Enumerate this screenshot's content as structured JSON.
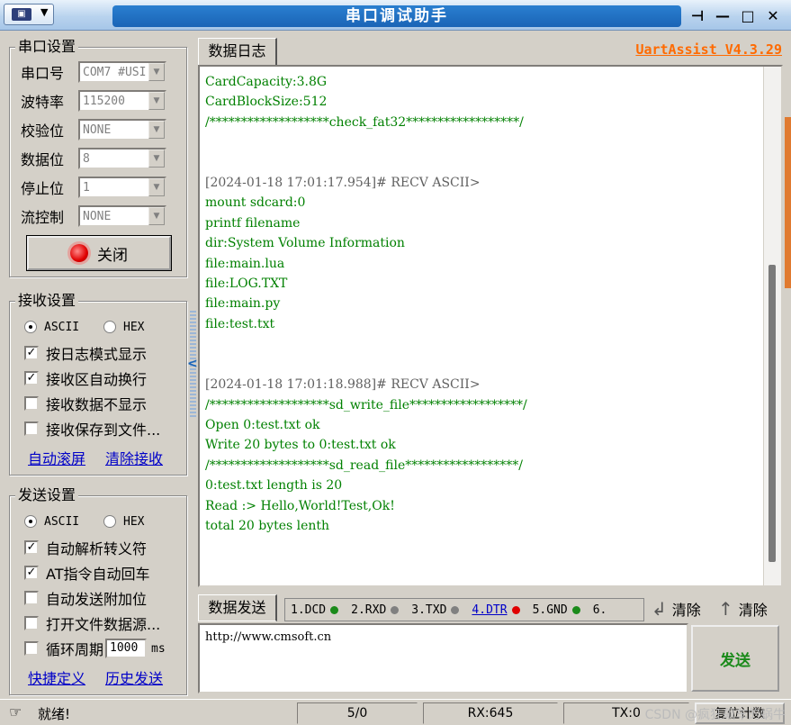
{
  "window": {
    "title": "串口调试助手",
    "brand": "UartAssist V4.3.29",
    "controls": [
      "⊣",
      "—",
      "□",
      "✕"
    ]
  },
  "serial": {
    "group_title": "串口设置",
    "rows": [
      {
        "label": "串口号",
        "value": "COM7 #USI"
      },
      {
        "label": "波特率",
        "value": "115200"
      },
      {
        "label": "校验位",
        "value": "NONE"
      },
      {
        "label": "数据位",
        "value": "8"
      },
      {
        "label": "停止位",
        "value": "1"
      },
      {
        "label": "流控制",
        "value": "NONE"
      }
    ],
    "close_button": "关闭"
  },
  "recv": {
    "group_title": "接收设置",
    "ascii": "ASCII",
    "hex": "HEX",
    "options": [
      {
        "label": "按日志模式显示",
        "checked": "✓"
      },
      {
        "label": "接收区自动换行",
        "checked": "✓"
      },
      {
        "label": "接收数据不显示",
        "checked": ""
      },
      {
        "label": "接收保存到文件...",
        "checked": ""
      }
    ],
    "link_autoscroll": "自动滚屏",
    "link_clear": "清除接收"
  },
  "send": {
    "group_title": "发送设置",
    "ascii": "ASCII",
    "hex": "HEX",
    "options": [
      {
        "label": "自动解析转义符",
        "checked": "✓"
      },
      {
        "label": "AT指令自动回车",
        "checked": "✓"
      },
      {
        "label": "自动发送附加位",
        "checked": ""
      },
      {
        "label": "打开文件数据源...",
        "checked": ""
      }
    ],
    "loop_label": "循环周期",
    "loop_value": "1000",
    "loop_unit": "ms",
    "link_shortcut": "快捷定义",
    "link_history": "历史发送"
  },
  "log": {
    "tab": "数据日志",
    "lines": [
      "CardCapacity:3.8G",
      "CardBlockSize:512",
      "/*******************check_fat32******************/",
      "",
      "",
      "[2024-01-18 17:01:17.954]# RECV ASCII>",
      "mount sdcard:0",
      "printf filename",
      "dir:System Volume Information",
      "file:main.lua",
      "file:LOG.TXT",
      "file:main.py",
      "file:test.txt",
      "",
      "",
      "[2024-01-18 17:01:18.988]# RECV ASCII>",
      "/*******************sd_write_file******************/",
      "Open 0:test.txt ok",
      "Write 20 bytes to 0:test.txt ok",
      "/*******************sd_read_file******************/",
      "0:test.txt length is 20",
      "Read :> Hello,World!Test,Ok!",
      "total 20 bytes lenth"
    ]
  },
  "sendarea": {
    "tab": "数据发送",
    "pins": [
      {
        "label": "1.DCD",
        "color": "#1a8a1a"
      },
      {
        "label": "2.RXD",
        "color": "#808080"
      },
      {
        "label": "3.TXD",
        "color": "#808080"
      },
      {
        "label": "4.DTR",
        "color": "#e00000"
      },
      {
        "label": "5.GND",
        "color": "#1a8a1a"
      },
      {
        "label": "6.",
        "color": ""
      }
    ],
    "clear1": "清除",
    "clear2": "清除",
    "text": "http://www.cmsoft.cn",
    "send_button": "发送"
  },
  "status": {
    "ready": "就绪!",
    "count": "5/0",
    "rx": "RX:645",
    "tx": "TX:0",
    "reset": "复位计数",
    "watermark": "CSDN @疯狂飙车的蜗牛"
  }
}
